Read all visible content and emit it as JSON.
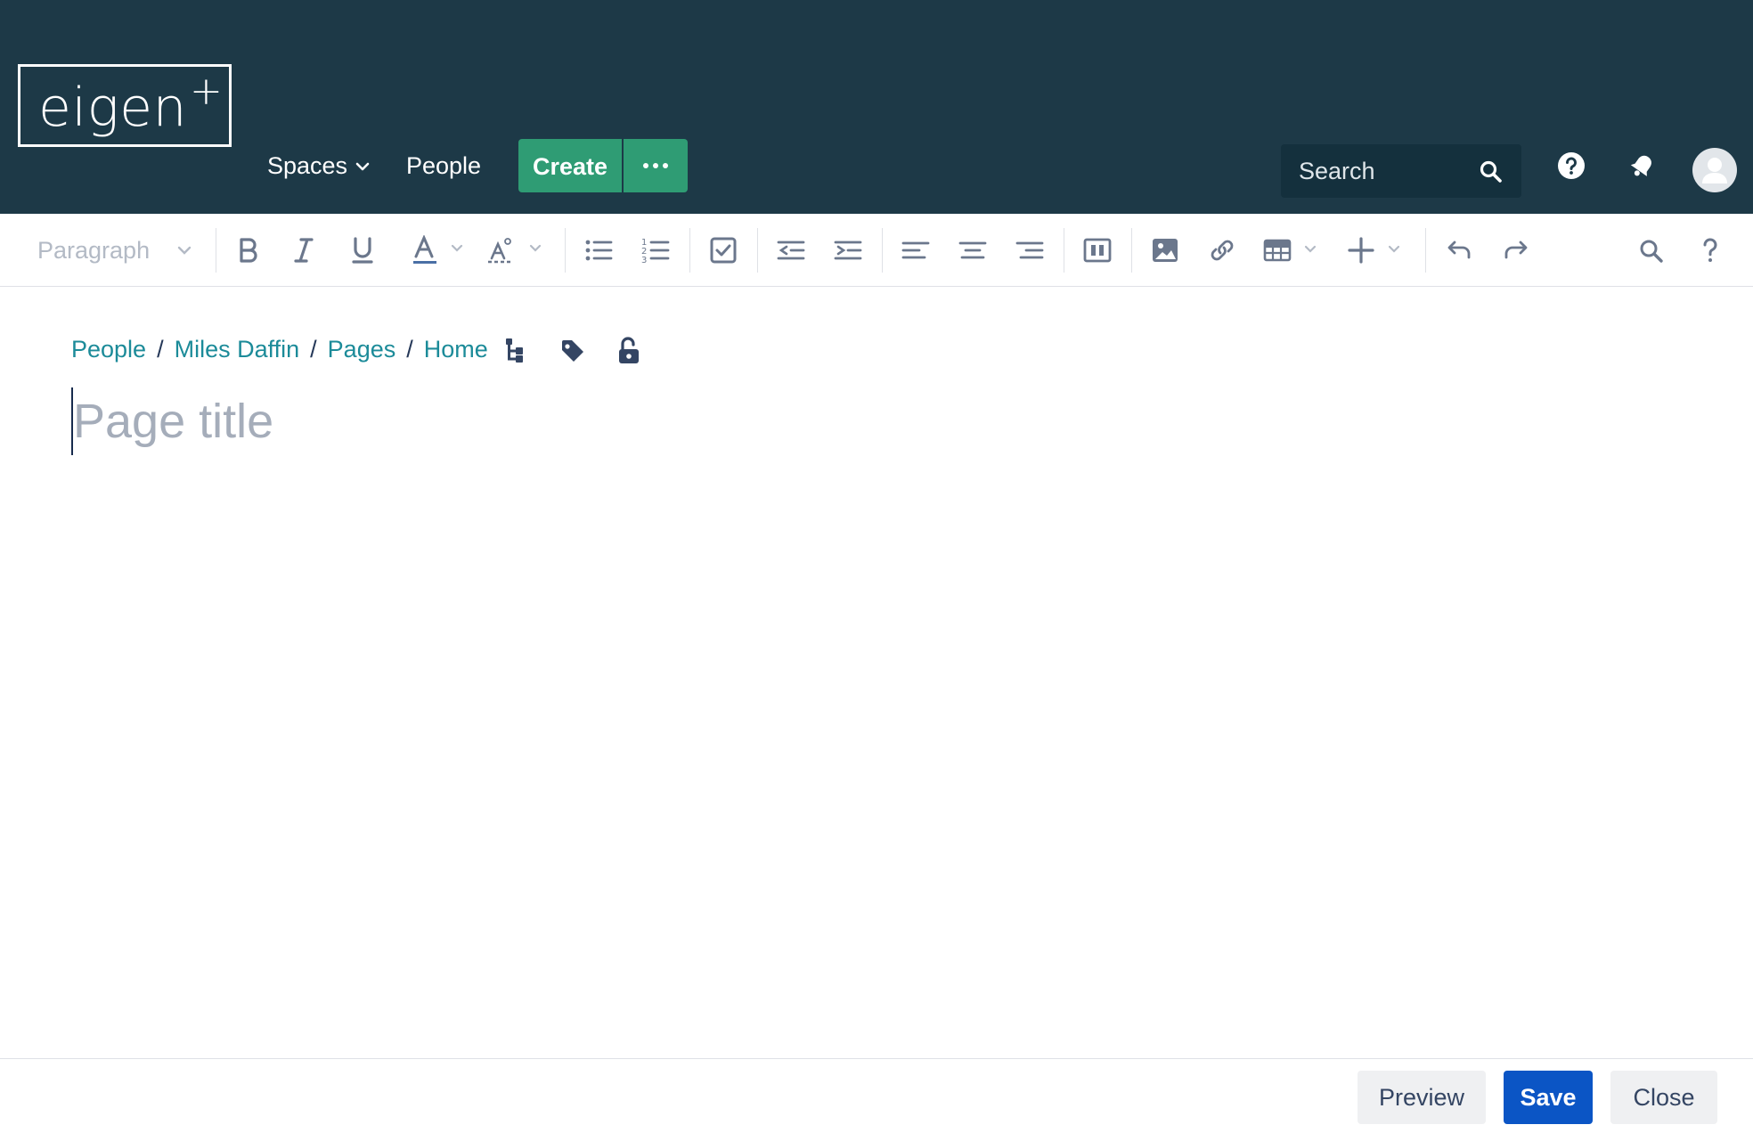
{
  "brand": {
    "logo_text": "eigen",
    "logo_mark": "+"
  },
  "nav": {
    "spaces_label": "Spaces",
    "people_label": "People",
    "create_label": "Create",
    "search_placeholder": "Search"
  },
  "toolbar": {
    "paragraph_style": "Paragraph",
    "icons": [
      "bold-icon",
      "italic-icon",
      "underline-icon",
      "text-color-icon",
      "text-style-icon",
      "bullet-list-icon",
      "numbered-list-icon",
      "task-list-icon",
      "outdent-icon",
      "indent-icon",
      "align-left-icon",
      "align-center-icon",
      "align-right-icon",
      "page-layout-icon",
      "image-icon",
      "link-icon",
      "table-icon",
      "insert-icon",
      "undo-icon",
      "redo-icon",
      "find-replace-icon",
      "help-icon"
    ]
  },
  "breadcrumb": {
    "items": [
      "People",
      "Miles Daffin",
      "Pages",
      "Home"
    ],
    "separator": "/"
  },
  "editor": {
    "title_placeholder": "Page title"
  },
  "footer": {
    "preview_label": "Preview",
    "save_label": "Save",
    "close_label": "Close"
  },
  "colors": {
    "header_bg": "#1d3947",
    "create_green": "#2f9c74",
    "link_teal": "#1c8b99",
    "save_blue": "#0b55c5"
  }
}
